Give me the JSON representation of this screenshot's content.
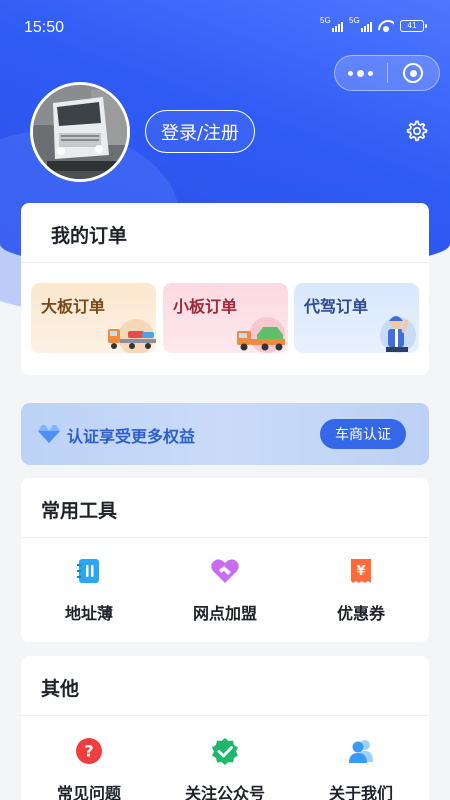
{
  "status_bar": {
    "time": "15:50",
    "signal_labels": [
      "5G",
      "5G"
    ],
    "battery": "41"
  },
  "header": {
    "login_label": "登录/注册",
    "avatar_icon": "truck-avatar",
    "settings_icon": "gear-icon"
  },
  "orders": {
    "title": "我的订单",
    "items": [
      {
        "label": "大板订单",
        "color": "#7a4a1a",
        "bg": "#fdecd8"
      },
      {
        "label": "小板订单",
        "color": "#9c2a3c",
        "bg": "#fde0e6"
      },
      {
        "label": "代驾订单",
        "color": "#2f4d8c",
        "bg": "#dfebfd"
      }
    ]
  },
  "certification": {
    "text": "认证享受更多权益",
    "button": "车商认证",
    "icon": "diamond-icon"
  },
  "tools": {
    "title": "常用工具",
    "items": [
      {
        "label": "地址薄",
        "icon": "address-book-icon"
      },
      {
        "label": "网点加盟",
        "icon": "handshake-heart-icon"
      },
      {
        "label": "优惠券",
        "icon": "coupon-icon"
      }
    ]
  },
  "others": {
    "title": "其他",
    "items": [
      {
        "label": "常见问题",
        "icon": "question-icon"
      },
      {
        "label": "关注公众号",
        "icon": "verified-check-icon"
      },
      {
        "label": "关于我们",
        "icon": "users-icon"
      }
    ]
  },
  "colors": {
    "brand_blue": "#2f5bf5",
    "button_blue": "#3468e8"
  }
}
